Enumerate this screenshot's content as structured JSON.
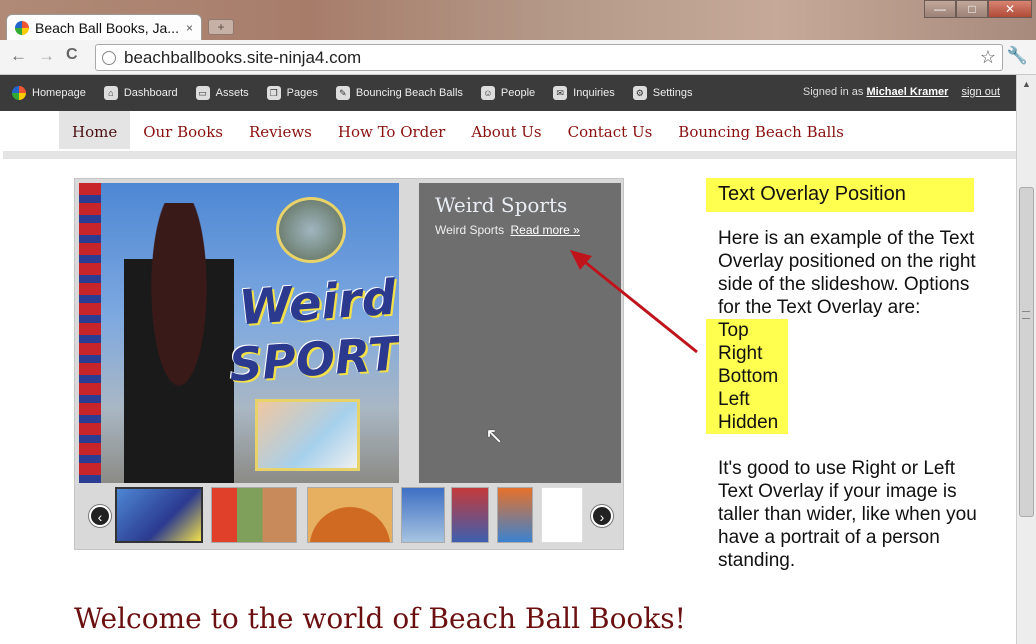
{
  "browser": {
    "tab_title": "Beach Ball Books, Ja...",
    "tab_close": "×",
    "newtab": "+",
    "url": "beachballbooks.site-ninja4.com",
    "back": "←",
    "forward": "→",
    "reload": "C",
    "star": "☆",
    "wrench": "🔧",
    "min": "—",
    "max": "□",
    "close": "✕"
  },
  "adminbar": {
    "items": [
      {
        "label": "Homepage",
        "icon": "ball-icon"
      },
      {
        "label": "Dashboard",
        "icon": "house-icon"
      },
      {
        "label": "Assets",
        "icon": "folder-icon"
      },
      {
        "label": "Pages",
        "icon": "pages-icon"
      },
      {
        "label": "Bouncing Beach Balls",
        "icon": "pencil-icon"
      },
      {
        "label": "People",
        "icon": "person-icon"
      },
      {
        "label": "Inquiries",
        "icon": "chat-icon"
      },
      {
        "label": "Settings",
        "icon": "gear-icon"
      }
    ],
    "signed_in_prefix": "Signed in as",
    "user": "Michael Kramer",
    "sign_out": "sign out"
  },
  "sitenav": {
    "items": [
      "Home",
      "Our Books",
      "Reviews",
      "How To Order",
      "About Us",
      "Contact Us",
      "Bouncing Beach Balls"
    ],
    "active": "Home"
  },
  "slideshow": {
    "cover_word1": "Weird",
    "cover_word2": "SPORTS",
    "overlay_title": "Weird Sports",
    "overlay_caption": "Weird Sports",
    "read_more": "Read more »",
    "prev": "‹",
    "next": "›"
  },
  "note": {
    "title": "Text Overlay Position",
    "body": "Here is an example of the Text Overlay positioned on the right side of the slideshow.  Options for the Text Overlay are:",
    "options": [
      "Top",
      "Right",
      "Bottom",
      "Left",
      "Hidden"
    ],
    "body2": "It's good to use Right or Left Text Overlay if your image is taller than wider, like when you have a portrait of a person standing."
  },
  "welcome": "Welcome to the world of Beach Ball Books!",
  "colors": {
    "nav_link": "#8b1010",
    "highlight": "#ffff4f",
    "overlay_bg": "#6e6e6e",
    "annotation_arrow": "#c0141c"
  }
}
